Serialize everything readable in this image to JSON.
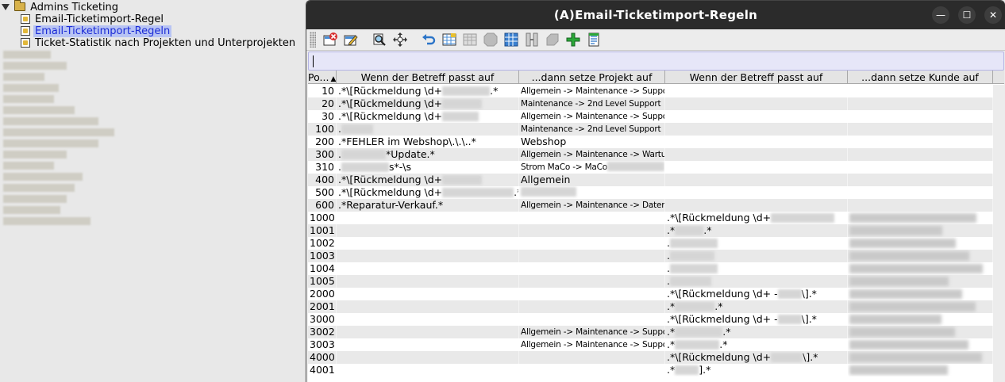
{
  "tree": {
    "root_label": "Admins Ticketing",
    "children": [
      {
        "label": "Email-Ticketimport-Regel",
        "selected": false
      },
      {
        "label": "Email-Ticketimport-Regeln",
        "selected": true
      },
      {
        "label": "Ticket-Statistik nach Projekten und Unterprojekten",
        "selected": false
      }
    ]
  },
  "window": {
    "title": "(A)Email-Ticketimport-Regeln",
    "controls": {
      "minimize": "—",
      "maximize": "☐",
      "close": "✕"
    }
  },
  "toolbar": {
    "buttons": [
      "delete",
      "edit",
      "search",
      "move",
      "undo",
      "new-record",
      "grid-disabled",
      "stop-disabled",
      "table",
      "columns",
      "print-disabled",
      "add-plus",
      "document"
    ]
  },
  "filter": {
    "value": "",
    "placeholder": ""
  },
  "table": {
    "columns": [
      {
        "label": "Po...",
        "sorted": "asc"
      },
      {
        "label": "Wenn der Betreff passt auf"
      },
      {
        "label": "...dann setze Projekt auf"
      },
      {
        "label": "Wenn der Betreff passt auf"
      },
      {
        "label": "...dann setze Kunde auf"
      }
    ],
    "rows": [
      {
        "pos": "10",
        "pattern1": ".*\\[Rückmeldung \\d+",
        "pattern1_tail": ".*",
        "project": "Allgemein -> Maintenance -> Support",
        "pattern2": "",
        "kunde": false
      },
      {
        "pos": "20",
        "pattern1": ".*\\[Rückmeldung \\d+",
        "pattern1_tail": "",
        "project": "Maintenance -> 2nd Level Support",
        "pattern2": "",
        "kunde": false
      },
      {
        "pos": "30",
        "pattern1": ".*\\[Rückmeldung \\d+",
        "pattern1_tail": "",
        "project": "Allgemein -> Maintenance -> Support",
        "pattern2": "",
        "kunde": false
      },
      {
        "pos": "100",
        "pattern1": ".",
        "pattern1_tail": "",
        "project": "Maintenance -> 2nd Level Support",
        "pattern2": "",
        "kunde": false
      },
      {
        "pos": "200",
        "pattern1": ".*FEHLER im Webshop\\.\\.\\..*",
        "pattern1_tail": "",
        "project": "Webshop",
        "project_large": true,
        "pattern2": "",
        "kunde": false
      },
      {
        "pos": "300",
        "pattern1": ".",
        "pattern1_tail": "*Update.*",
        "project": "Allgemein -> Maintenance -> Wartu...",
        "pattern2": "",
        "kunde": false
      },
      {
        "pos": "310",
        "pattern1": ".",
        "pattern1_tail": "s*-\\s",
        "project": "Strom MaCo -> MaCo",
        "pattern2": "",
        "kunde": false
      },
      {
        "pos": "400",
        "pattern1": ".*\\[Rückmeldung \\d+",
        "pattern1_tail": "",
        "project": "Allgemein",
        "project_large": true,
        "pattern2": "",
        "kunde": false
      },
      {
        "pos": "500",
        "pattern1": ".*\\[Rückmeldung \\d+",
        "pattern1_tail": ".*",
        "project": "",
        "pattern2": "",
        "kunde": false
      },
      {
        "pos": "600",
        "pattern1": ".*Reparatur-Verkauf.*",
        "pattern1_tail": "",
        "project": "Allgemein -> Maintenance -> Daten...",
        "pattern2": "",
        "kunde": false
      },
      {
        "pos": "1000",
        "pattern1": "",
        "pattern1_tail": "",
        "project": "",
        "pattern2": ".*\\[Rückmeldung \\d+",
        "pattern2_tail": "",
        "kunde": true
      },
      {
        "pos": "1001",
        "pattern1": "",
        "pattern1_tail": "",
        "project": "",
        "pattern2": ".*",
        "pattern2_tail": ".*",
        "kunde": true
      },
      {
        "pos": "1002",
        "pattern1": "",
        "pattern1_tail": "",
        "project": "",
        "pattern2": ".",
        "pattern2_tail": "",
        "kunde": true
      },
      {
        "pos": "1003",
        "pattern1": "",
        "pattern1_tail": "",
        "project": "",
        "pattern2": ".",
        "pattern2_tail": "",
        "kunde": true
      },
      {
        "pos": "1004",
        "pattern1": "",
        "pattern1_tail": "",
        "project": "",
        "pattern2": ".",
        "pattern2_tail": "",
        "kunde": true
      },
      {
        "pos": "1005",
        "pattern1": "",
        "pattern1_tail": "",
        "project": "",
        "pattern2": ".",
        "pattern2_tail": "",
        "kunde": true
      },
      {
        "pos": "2000",
        "pattern1": "",
        "pattern1_tail": "",
        "project": "",
        "pattern2": ".*\\[Rückmeldung \\d+ -",
        "pattern2_tail": "\\].*",
        "kunde": true
      },
      {
        "pos": "2001",
        "pattern1": "",
        "pattern1_tail": "",
        "project": "",
        "pattern2": ".*",
        "pattern2_tail": ".*",
        "kunde": true
      },
      {
        "pos": "3000",
        "pattern1": "",
        "pattern1_tail": "",
        "project": "",
        "pattern2": ".*\\[Rückmeldung \\d+ -",
        "pattern2_tail": "\\].*",
        "kunde": true
      },
      {
        "pos": "3002",
        "pattern1": "",
        "pattern1_tail": "",
        "project": "Allgemein -> Maintenance -> Support",
        "pattern2": ".*",
        "pattern2_tail": ".*",
        "kunde": true
      },
      {
        "pos": "3003",
        "pattern1": "",
        "pattern1_tail": "",
        "project": "Allgemein -> Maintenance -> Support",
        "pattern2": ".*",
        "pattern2_tail": ".*",
        "kunde": true
      },
      {
        "pos": "4000",
        "pattern1": "",
        "pattern1_tail": "",
        "project": "",
        "pattern2": ".*\\[Rückmeldung \\d+",
        "pattern2_tail": "\\].*",
        "kunde": true
      },
      {
        "pos": "4001",
        "pattern1": "",
        "pattern1_tail": "",
        "project": "",
        "pattern2": ".*",
        "pattern2_tail": "].*",
        "kunde": true
      }
    ]
  },
  "colors": {
    "titlebar": "#2b2b2b",
    "selection_bg": "#b8c4f4",
    "selection_fg": "#1b2bd6",
    "row_alt": "#e9e9e9",
    "filter_bg": "#e6e6f8"
  }
}
